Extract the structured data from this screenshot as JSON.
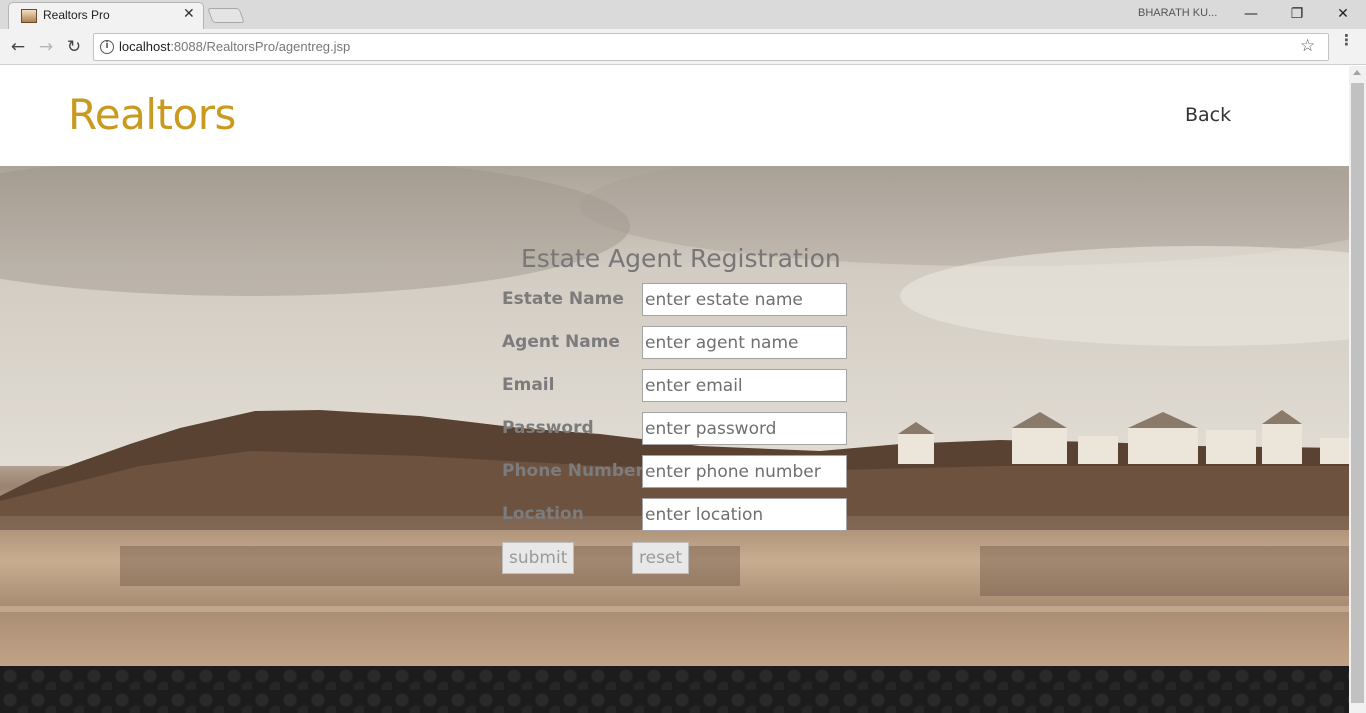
{
  "browser": {
    "tab_title": "Realtors Pro",
    "tab_close": "✕",
    "profile_name": "BHARATH KU...",
    "window_controls": {
      "minimize": "—",
      "maximize": "❐",
      "close": "✕"
    },
    "nav": {
      "back": "←",
      "forward": "→",
      "reload": "↻"
    },
    "url_host": "localhost",
    "url_rest": ":8088/RealtorsPro/agentreg.jsp",
    "info_icon": "i",
    "star_icon": "☆",
    "menu_icon": "⋮"
  },
  "header": {
    "brand": "Realtors",
    "back_link": "Back"
  },
  "form": {
    "title": "Estate Agent Registration",
    "fields": [
      {
        "label": "Estate Name",
        "placeholder": "enter estate name",
        "value": ""
      },
      {
        "label": "Agent Name",
        "placeholder": "enter agent name",
        "value": ""
      },
      {
        "label": "Email",
        "placeholder": "enter email",
        "value": ""
      },
      {
        "label": "Password",
        "placeholder": "enter password",
        "value": ""
      },
      {
        "label": "Phone Number",
        "placeholder": "enter phone number",
        "value": ""
      },
      {
        "label": "Location",
        "placeholder": "enter location",
        "value": ""
      }
    ],
    "submit_label": "submit",
    "reset_label": "reset"
  },
  "colors": {
    "brand": "#c99a1f",
    "footer": "#1c1c1c",
    "label": "#7c7c7c"
  }
}
